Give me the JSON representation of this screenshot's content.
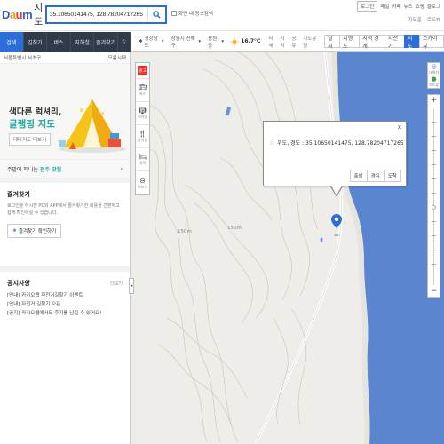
{
  "header": {
    "logo_brand": "Daum",
    "logo_service": "지도",
    "search_value": "35.10650141475, 128.78204717265",
    "nearby_label": "화면 내 장소검색",
    "topnav": [
      "로그인",
      "메일",
      "카페",
      "뉴스",
      "쇼핑",
      "블로그"
    ],
    "subnav": [
      "지도홈",
      "로드뷰"
    ]
  },
  "left_tabs": [
    "검색",
    "길찾기",
    "버스",
    "지하철",
    "즐겨찾기",
    "☆"
  ],
  "left_panel": {
    "location": "서울특별시 서초구",
    "location_action": "모름시대",
    "banner": {
      "title_line1": "색다른 럭셔리,",
      "title_line2": "글램핑 지도",
      "button": "테마지도 더보기"
    },
    "promo": {
      "prefix": "주말에 떠나는",
      "highlight": "전주 맛집",
      "arrow": "›"
    },
    "favorites": {
      "title": "즐겨찾기",
      "desc": "로그인을 하시면 PC와 APP에서 즐겨찾기한 내용을 간편하고 쉽게 확인하실 수 있습니다.",
      "button": "즐겨찾기 확인하기"
    },
    "notice": {
      "title": "공지사항",
      "more": "더보기",
      "items": [
        "[안내] 카카오맵 자전거길찾기 이벤트",
        "[안내] 자전거 길찾기 오픈",
        "[공지] 카카오맵에서도 후기를 남길 수 있어요!"
      ]
    }
  },
  "map_toolbar": {
    "breadcrumbs": [
      "경상남도",
      "창원시 진해구",
      "용원동"
    ],
    "temperature": "16.7°C",
    "toggles": [
      "미세",
      "지적",
      "공유",
      "지도유형"
    ],
    "layers": [
      {
        "label": "날씨",
        "active": false
      },
      {
        "label": "지형도",
        "active": false
      },
      {
        "label": "지적 경계",
        "active": false
      },
      {
        "label": "자전거",
        "active": false
      },
      {
        "label": "지도",
        "active": true
      },
      {
        "label": "스카이뷰",
        "active": false
      }
    ]
  },
  "map": {
    "left_tools": [
      {
        "icon": "bus-icon",
        "label": "버스"
      },
      {
        "icon": "subway-icon",
        "label": "지하철"
      },
      {
        "icon": "food-icon",
        "label": "음식점"
      },
      {
        "icon": "hotel-icon",
        "label": "숙박"
      },
      {
        "icon": "more-icon",
        "label": "더보기"
      }
    ],
    "left_tools_top": "광고",
    "contour_labels": [
      "150m",
      "150m"
    ],
    "popup": {
      "coord_text": "위도, 경도 : 35.10650141475, 128.78204717265",
      "actions": [
        "출발",
        "경유",
        "도착"
      ],
      "close": "x"
    },
    "right_tools": [
      {
        "icon": "location-icon",
        "label": "내위치"
      },
      {
        "icon": "roadview-icon",
        "label": "로드뷰"
      }
    ],
    "zoom_plus": "+",
    "zoom_minus": "−",
    "collapse": "◂"
  },
  "colors": {
    "accent": "#2b6ddb",
    "sea": "#5a86cf",
    "land": "#eeede9",
    "tabbar": "#2f3b4a"
  }
}
